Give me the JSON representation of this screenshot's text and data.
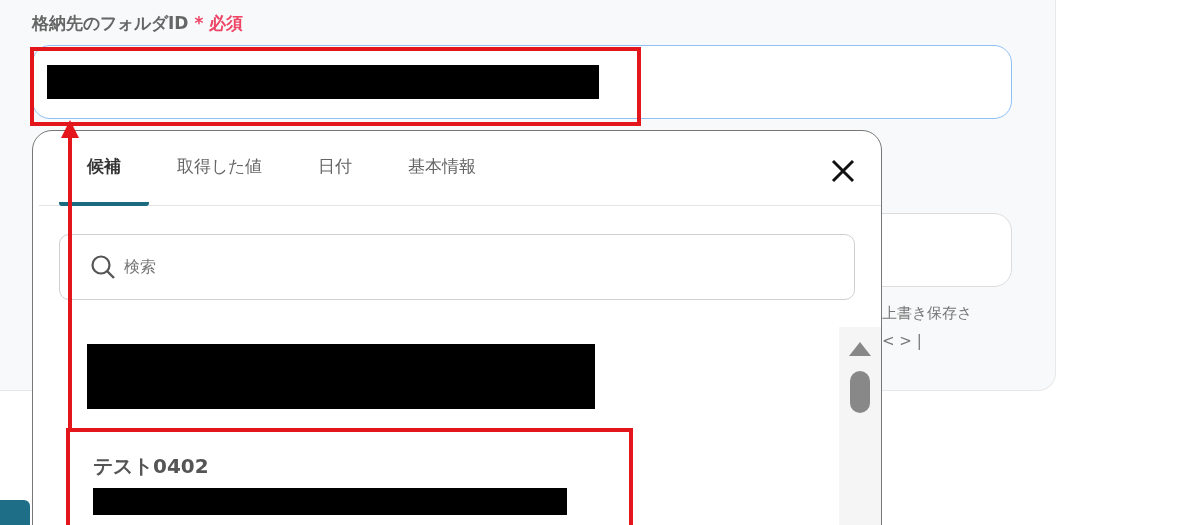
{
  "form": {
    "field_label": "格納先のフォルダID",
    "required_mark": "*",
    "required_label": "必須",
    "hint_lines": [
      "上書き保存さ",
      "< > |"
    ]
  },
  "popup": {
    "tabs": [
      {
        "label": "候補",
        "selected": true
      },
      {
        "label": "取得した値",
        "selected": false
      },
      {
        "label": "日付",
        "selected": false
      },
      {
        "label": "基本情報",
        "selected": false
      }
    ],
    "search": {
      "placeholder": "検索"
    },
    "suggestions": [
      {
        "kind": "redacted"
      },
      {
        "kind": "titled",
        "title": "テスト0402"
      }
    ]
  }
}
